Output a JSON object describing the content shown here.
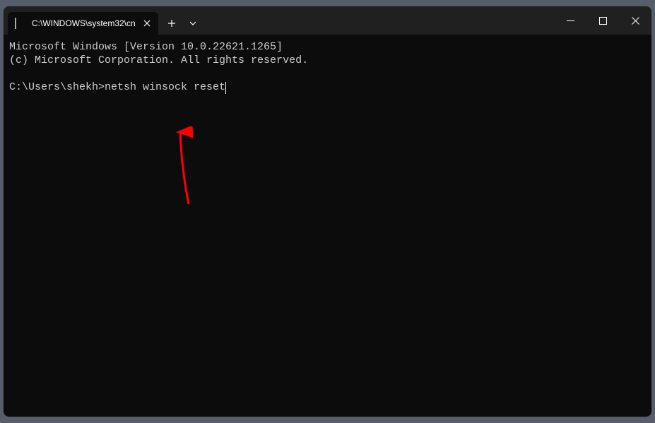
{
  "titlebar": {
    "tab_title": "C:\\WINDOWS\\system32\\cn",
    "tab_icon": "terminal-icon",
    "tab_close_label": "✕",
    "new_tab_label": "+",
    "dropdown_label": "⌄",
    "minimize_label": "—",
    "maximize_label": "□",
    "close_label": "✕"
  },
  "terminal": {
    "line1": "Microsoft Windows [Version 10.0.22621.1265]",
    "line2": "(c) Microsoft Corporation. All rights reserved.",
    "blank": "",
    "prompt": "C:\\Users\\shekh>",
    "command": "netsh winsock reset"
  }
}
